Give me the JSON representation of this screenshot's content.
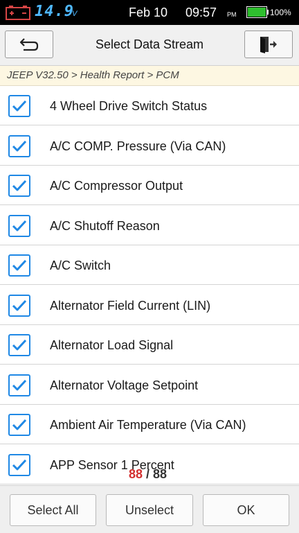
{
  "status_bar": {
    "voltage": "14.9",
    "voltage_unit": "V",
    "date": "Feb 10",
    "time": "09:57",
    "ampm": "PM",
    "battery_percent": "100%",
    "battery_level": 1.0,
    "battery_color": "#2fbf2f"
  },
  "title_bar": {
    "title": "Select Data Stream",
    "back_icon": "back-arrow-icon",
    "exit_icon": "exit-door-icon"
  },
  "breadcrumb": "JEEP V32.50 > Health Report > PCM",
  "items": [
    {
      "label": "4 Wheel Drive Switch Status",
      "checked": true
    },
    {
      "label": "A/C COMP. Pressure (Via CAN)",
      "checked": true
    },
    {
      "label": "A/C Compressor Output",
      "checked": true
    },
    {
      "label": "A/C Shutoff Reason",
      "checked": true
    },
    {
      "label": "A/C Switch",
      "checked": true
    },
    {
      "label": "Alternator Field Current (LIN)",
      "checked": true
    },
    {
      "label": "Alternator Load Signal",
      "checked": true
    },
    {
      "label": "Alternator Voltage Setpoint",
      "checked": true
    },
    {
      "label": "Ambient Air Temperature (Via CAN)",
      "checked": true
    },
    {
      "label": "APP Sensor 1 Percent",
      "checked": true
    }
  ],
  "counter": {
    "selected": "88",
    "separator": " / ",
    "total": "88"
  },
  "buttons": {
    "select_all": "Select All",
    "unselect": "Unselect",
    "ok": "OK"
  },
  "colors": {
    "checkbox_accent": "#1f88e5",
    "counter_selected": "#d32f2f",
    "voltage_text": "#4fb8ff"
  }
}
